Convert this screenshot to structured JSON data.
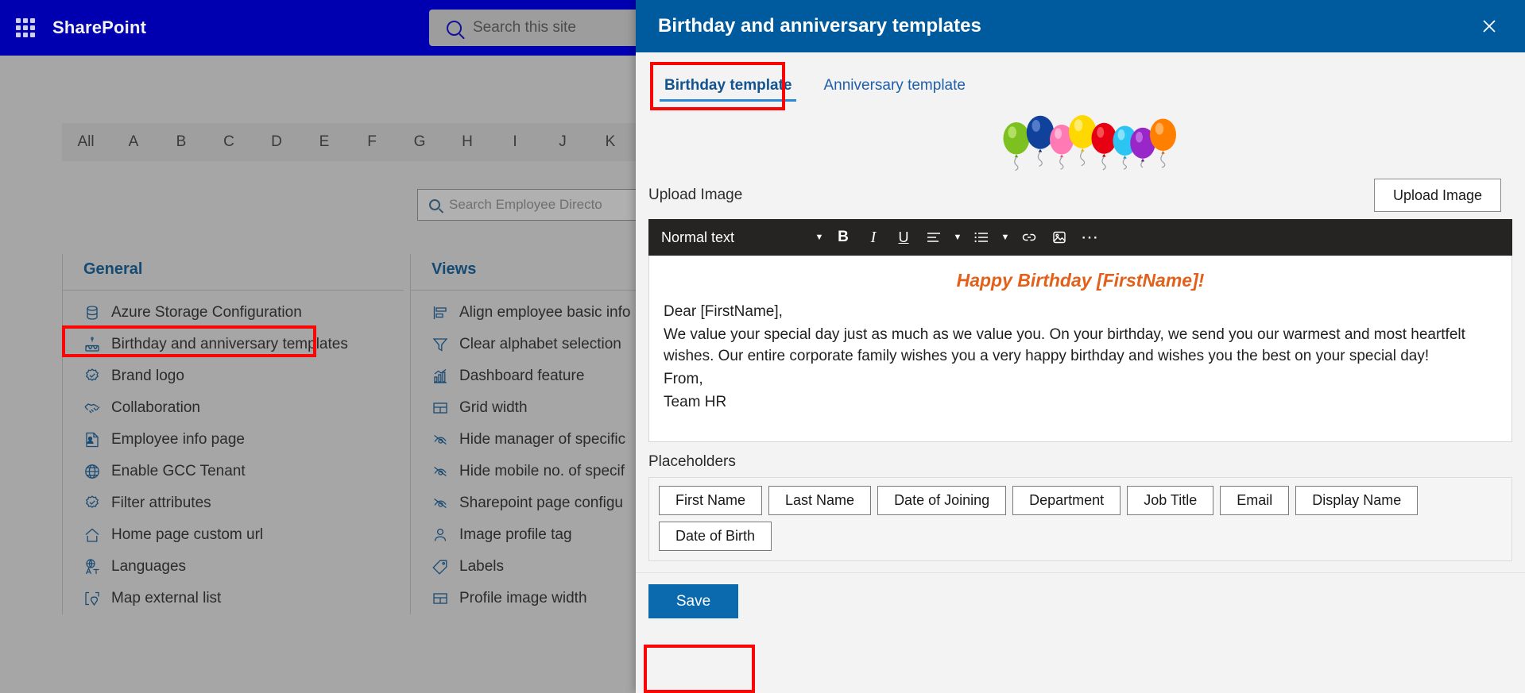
{
  "suitebar": {
    "waffle_icon": "app-launcher-icon",
    "brand": "SharePoint",
    "search_placeholder": "Search this site",
    "search_icon": "search-icon"
  },
  "alphabet_bar": {
    "items": [
      "All",
      "A",
      "B",
      "C",
      "D",
      "E",
      "F",
      "G",
      "H",
      "I",
      "J",
      "K"
    ]
  },
  "directory_search": {
    "placeholder": "Search Employee Directo",
    "icon": "search-icon"
  },
  "columns": [
    {
      "heading": "General",
      "items": [
        {
          "label": "Azure Storage Configuration",
          "icon": "database-icon"
        },
        {
          "label": "Birthday and anniversary templates",
          "icon": "cake-icon"
        },
        {
          "label": "Brand logo",
          "icon": "badge-check-icon"
        },
        {
          "label": "Collaboration",
          "icon": "handshake-icon"
        },
        {
          "label": "Employee info page",
          "icon": "person-card-icon"
        },
        {
          "label": "Enable GCC Tenant",
          "icon": "globe-icon"
        },
        {
          "label": "Filter attributes",
          "icon": "badge-check-icon"
        },
        {
          "label": "Home page custom url",
          "icon": "home-icon"
        },
        {
          "label": "Languages",
          "icon": "translate-icon"
        },
        {
          "label": "Map external list",
          "icon": "map-list-icon"
        }
      ]
    },
    {
      "heading": "Views",
      "items": [
        {
          "label": "Align employee basic info",
          "icon": "align-icon"
        },
        {
          "label": "Clear alphabet selection",
          "icon": "filter-icon"
        },
        {
          "label": "Dashboard feature",
          "icon": "chart-icon"
        },
        {
          "label": "Grid width",
          "icon": "grid-icon"
        },
        {
          "label": "Hide manager of specific",
          "icon": "hide-eye-icon"
        },
        {
          "label": "Hide mobile no. of specif",
          "icon": "hide-eye-icon"
        },
        {
          "label": "Sharepoint page configu",
          "icon": "hide-eye-icon"
        },
        {
          "label": "Image profile tag",
          "icon": "person-icon"
        },
        {
          "label": "Labels",
          "icon": "tag-icon"
        },
        {
          "label": "Profile image width",
          "icon": "grid-icon"
        }
      ]
    }
  ],
  "panel": {
    "title": "Birthday and anniversary templates",
    "close_icon": "close-icon",
    "tabs": [
      {
        "label": "Birthday template",
        "active": true
      },
      {
        "label": "Anniversary template",
        "active": false
      }
    ],
    "hero_image": "balloons-image",
    "upload": {
      "label": "Upload Image",
      "button_label": "Upload Image"
    },
    "editor": {
      "style_label": "Normal text",
      "toolbar_icons": [
        "style-dropdown-caret-icon",
        "bold-icon",
        "italic-icon",
        "underline-icon",
        "align-left-icon",
        "align-dropdown-caret-icon",
        "bullet-list-icon",
        "list-dropdown-caret-icon",
        "link-icon",
        "insert-image-icon",
        "more-options-icon"
      ],
      "title": "Happy Birthday [FirstName]!",
      "lines": [
        "Dear [FirstName],",
        "We value your special day just as much as we value you. On your birthday, we send you our warmest and most heartfelt wishes. Our entire corporate family wishes you a very happy birthday and wishes you the best on your special day!",
        "From,",
        "Team HR"
      ],
      "title_color": "#e2601a"
    },
    "placeholders": {
      "label": "Placeholders",
      "items": [
        "First Name",
        "Last Name",
        "Date of Joining",
        "Department",
        "Job Title",
        "Email",
        "Display Name",
        "Date of Birth"
      ]
    },
    "save_label": "Save"
  },
  "colors": {
    "suitebar": "#0000b0",
    "panel_header": "#005a9e",
    "tab_active": "#13538f",
    "tab_underline": "#2b88d8",
    "highlight": "#fb0505",
    "save_button": "#0a6aad",
    "toolbar": "#252423"
  }
}
